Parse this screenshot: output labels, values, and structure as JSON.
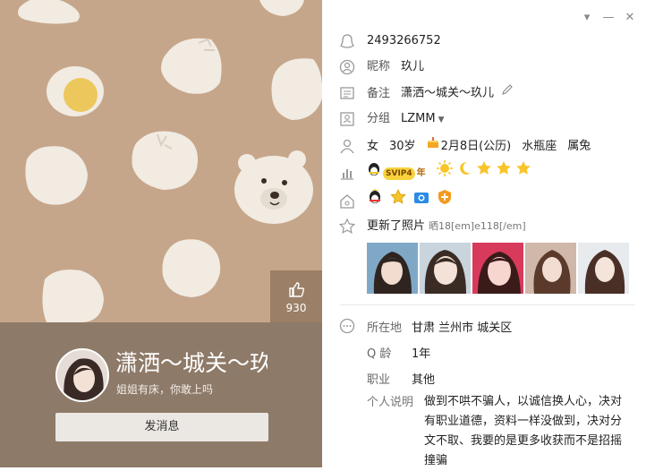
{
  "window_controls": {
    "dropdown": "▾",
    "minimize": "—",
    "close": "✕"
  },
  "cover": {
    "likes": "930"
  },
  "profile": {
    "display_name": "潇洒～城关～玖儿",
    "signature": "姐姐有床，你敢上吗",
    "send_message_label": "发消息"
  },
  "details": {
    "qq_number": "2493266752",
    "nickname_label": "昵称",
    "nickname": "玖儿",
    "remark_label": "备注",
    "remark": "潇洒～城关～玖儿",
    "group_label": "分组",
    "group": "LZMM",
    "gender": "女",
    "age": "30岁",
    "birthday": "2月8日(公历)",
    "zodiac": "水瓶座",
    "chinese_zodiac": "属兔",
    "svip_badge": "SVIP4",
    "svip_year": "年",
    "photos_updated": "更新了照片",
    "photos_meta": "晒18[em]e118[/em]"
  },
  "info": {
    "location_label": "所在地",
    "location": "甘肃 兰州市 城关区",
    "qage_label": "Q 龄",
    "qage": "1年",
    "job_label": "职业",
    "job": "其他",
    "intro_label": "个人说明",
    "intro": "做到不哄不骗人，以诚信换人心，决对有职业道德，资料一样没做到，决对分文不取、我要的是更多收获而不是招摇撞骗"
  },
  "colors": {
    "cover_bg": "#c6a68a",
    "bun": "#f1ebe2",
    "band": "#8e7a68",
    "accent_yellow": "#f5c518"
  }
}
